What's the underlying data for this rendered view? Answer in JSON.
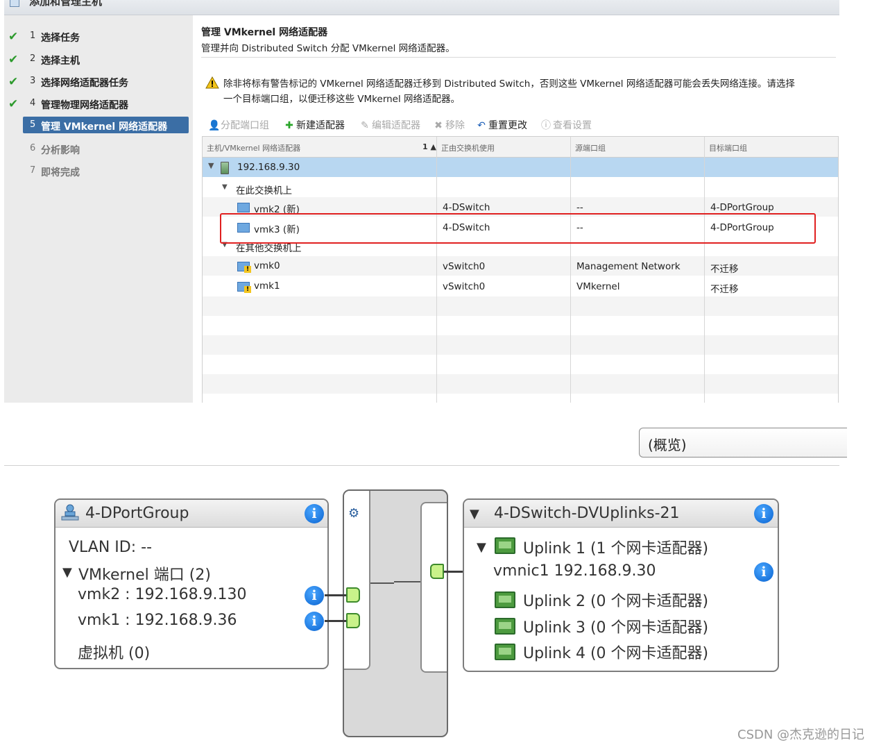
{
  "wizard": {
    "title": "添加和管理主机",
    "steps": [
      {
        "num": "1",
        "label": "选择任务",
        "state": "done"
      },
      {
        "num": "2",
        "label": "选择主机",
        "state": "done"
      },
      {
        "num": "3",
        "label": "选择网络适配器任务",
        "state": "done"
      },
      {
        "num": "4",
        "label": "管理物理网络适配器",
        "state": "done"
      },
      {
        "num": "5",
        "label": "管理 VMkernel 网络适配器",
        "state": "active"
      },
      {
        "num": "6",
        "label": "分析影响",
        "state": "todo"
      },
      {
        "num": "7",
        "label": "即将完成",
        "state": "todo"
      }
    ],
    "check_glyph": "✔"
  },
  "content": {
    "title": "管理 VMkernel 网络适配器",
    "subtitle": "管理并向 Distributed Switch 分配 VMkernel 网络适配器。",
    "warning_icon": "warning-icon",
    "warning_line1": "除非将标有警告标记的 VMkernel 网络适配器迁移到 Distributed Switch，否则这些 VMkernel 网络适配器可能会丢失网络连接。请选择",
    "warning_line2": "一个目标端口组，以便迁移这些 VMkernel 网络适配器。",
    "toolbar": {
      "assign": "分配端口组",
      "new": "新建适配器",
      "edit": "编辑适配器",
      "remove": "移除",
      "reset": "重置更改",
      "view": "查看设置"
    },
    "grid": {
      "columns": [
        "主机/VMkernel 网络适配器",
        "正由交换机使用",
        "源端口组",
        "目标端口组"
      ],
      "sort_marker": "1 ▲",
      "host": "192.168.9.30",
      "group_on_switch": "在此交换机上",
      "group_other": "在其他交换机上",
      "rows": [
        {
          "name": "vmk2 (新)",
          "switch": "4-DSwitch",
          "source": "--",
          "target": "4-DPortGroup",
          "warn": false
        },
        {
          "name": "vmk3 (新)",
          "switch": "4-DSwitch",
          "source": "--",
          "target": "4-DPortGroup",
          "warn": false
        },
        {
          "name": "vmk0",
          "switch": "vSwitch0",
          "source": "Management Network",
          "target": "不迁移",
          "warn": true
        },
        {
          "name": "vmk1",
          "switch": "vSwitch0",
          "source": "VMkernel",
          "target": "不迁移",
          "warn": true
        }
      ]
    }
  },
  "overview_button": "(概览)",
  "diagram": {
    "portgroup": {
      "title": "4-DPortGroup",
      "vlan": "VLAN ID: --",
      "vmk_ports": "VMkernel 端口 (2)",
      "vmk2": "vmk2 : 192.168.9.130",
      "vmk1": "vmk1 : 192.168.9.36",
      "vms": "虚拟机 (0)"
    },
    "uplinks": {
      "title": "4-DSwitch-DVUplinks-21",
      "uplink1": "Uplink 1 (1 个网卡适配器)",
      "vmnic1": "vmnic1 192.168.9.30",
      "uplink2": "Uplink 2 (0 个网卡适配器)",
      "uplink3": "Uplink 3 (0 个网卡适配器)",
      "uplink4": "Uplink 4 (0 个网卡适配器)"
    },
    "info_glyph": "i"
  },
  "watermark": "CSDN @杰克逊的日记"
}
